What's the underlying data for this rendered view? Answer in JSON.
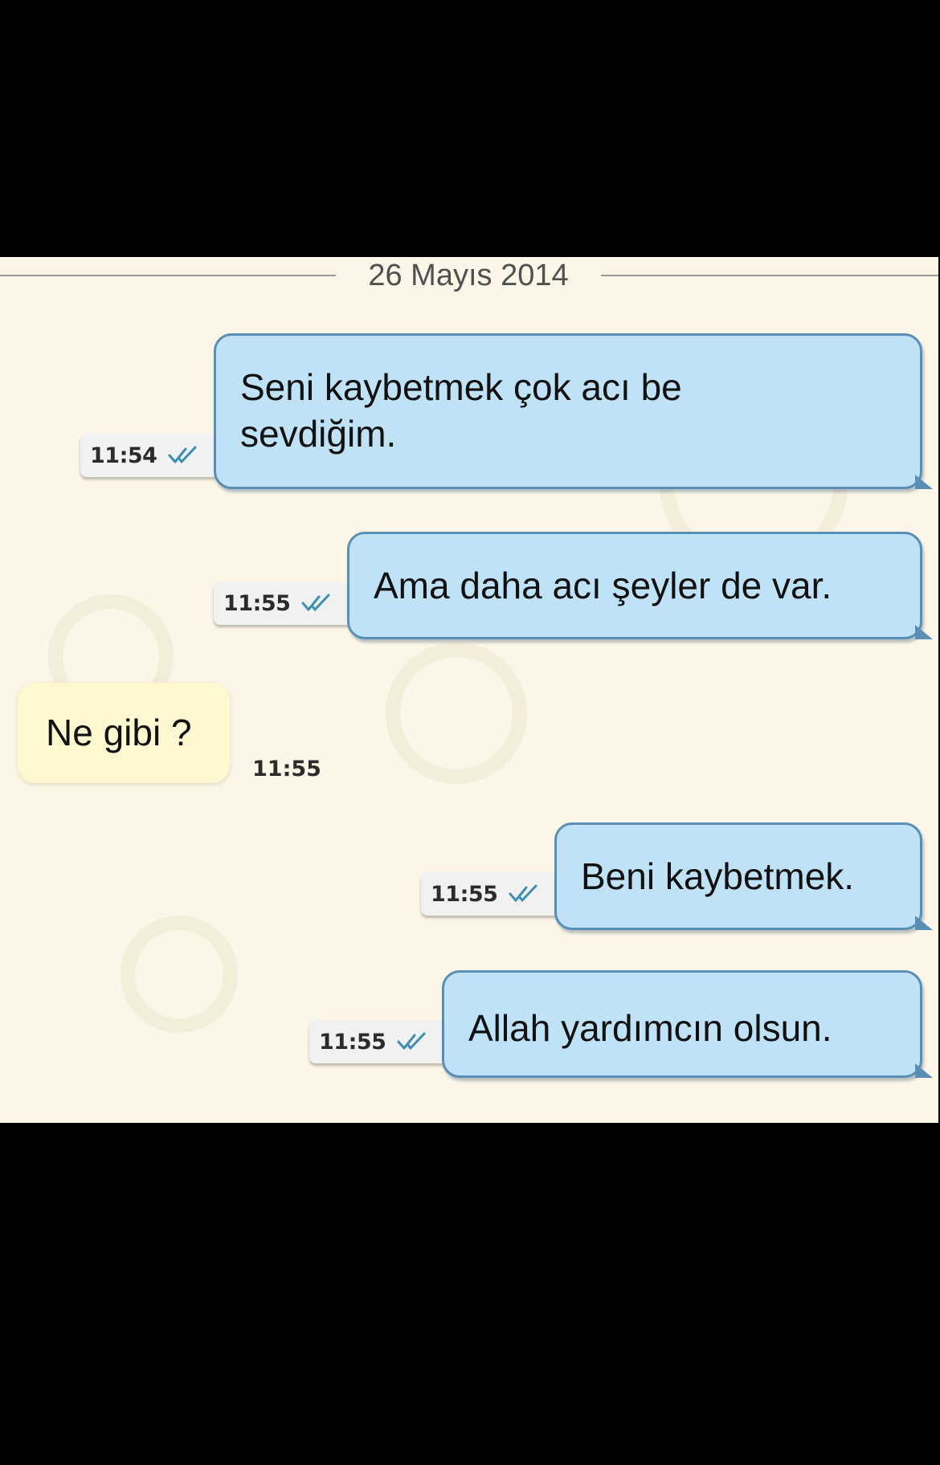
{
  "chat": {
    "date_label": "26 Mayıs 2014",
    "messages": [
      {
        "direction": "out",
        "text": "Seni kaybetmek çok acı be\nsevdiğim.",
        "time": "11:54",
        "status": "double-check-icon"
      },
      {
        "direction": "out",
        "text": "Ama daha acı şeyler de var.",
        "time": "11:55",
        "status": "double-check-icon"
      },
      {
        "direction": "in",
        "text": "Ne gibi ?",
        "time": "11:55"
      },
      {
        "direction": "out",
        "text": "Beni kaybetmek.",
        "time": "11:55",
        "status": "double-check-icon"
      },
      {
        "direction": "out",
        "text": "Allah yardımcın olsun.",
        "time": "11:55",
        "status": "double-check-icon"
      }
    ]
  },
  "colors": {
    "background": "#fbf6e7",
    "outgoing_bubble": "#bfe2f6",
    "outgoing_border": "#5a8fb5",
    "incoming_bubble": "#fdf8cf",
    "tick": "#3c8fb0"
  }
}
